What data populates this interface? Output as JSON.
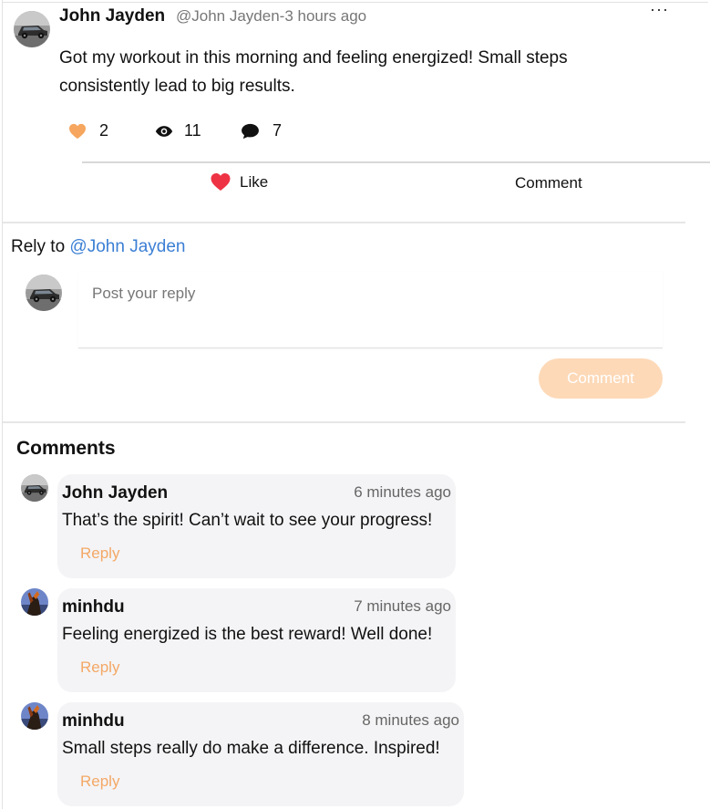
{
  "post": {
    "author": "John Jayden",
    "meta": "@John Jayden-3 hours ago",
    "more_label": "···",
    "body": "Got my workout in this morning and feeling energized! Small steps consistently lead to big results.",
    "likes": "2",
    "views": "11",
    "comments": "7",
    "like_label": "Like",
    "comment_label": "Comment"
  },
  "reply": {
    "prefix": "Rely to",
    "mention": "@John Jayden",
    "placeholder": "Post your reply",
    "submit_label": "Comment"
  },
  "comments": {
    "heading": "Comments",
    "items": [
      {
        "author": "John Jayden",
        "time": "6 minutes ago",
        "text": "That’s the spirit! Can’t wait to see your progress!",
        "reply_label": "Reply"
      },
      {
        "author": "minhdu",
        "time": "7 minutes ago",
        "text": "Feeling energized is the best reward! Well done!",
        "reply_label": "Reply"
      },
      {
        "author": "minhdu",
        "time": "8 minutes ago",
        "text": "Small steps really do make a difference. Inspired!",
        "reply_label": "Reply"
      }
    ]
  },
  "colors": {
    "accent": "#f4a866",
    "mention": "#3b7fd4",
    "like_heart": "#ee3344",
    "submit_bg": "#fdd9b8"
  }
}
